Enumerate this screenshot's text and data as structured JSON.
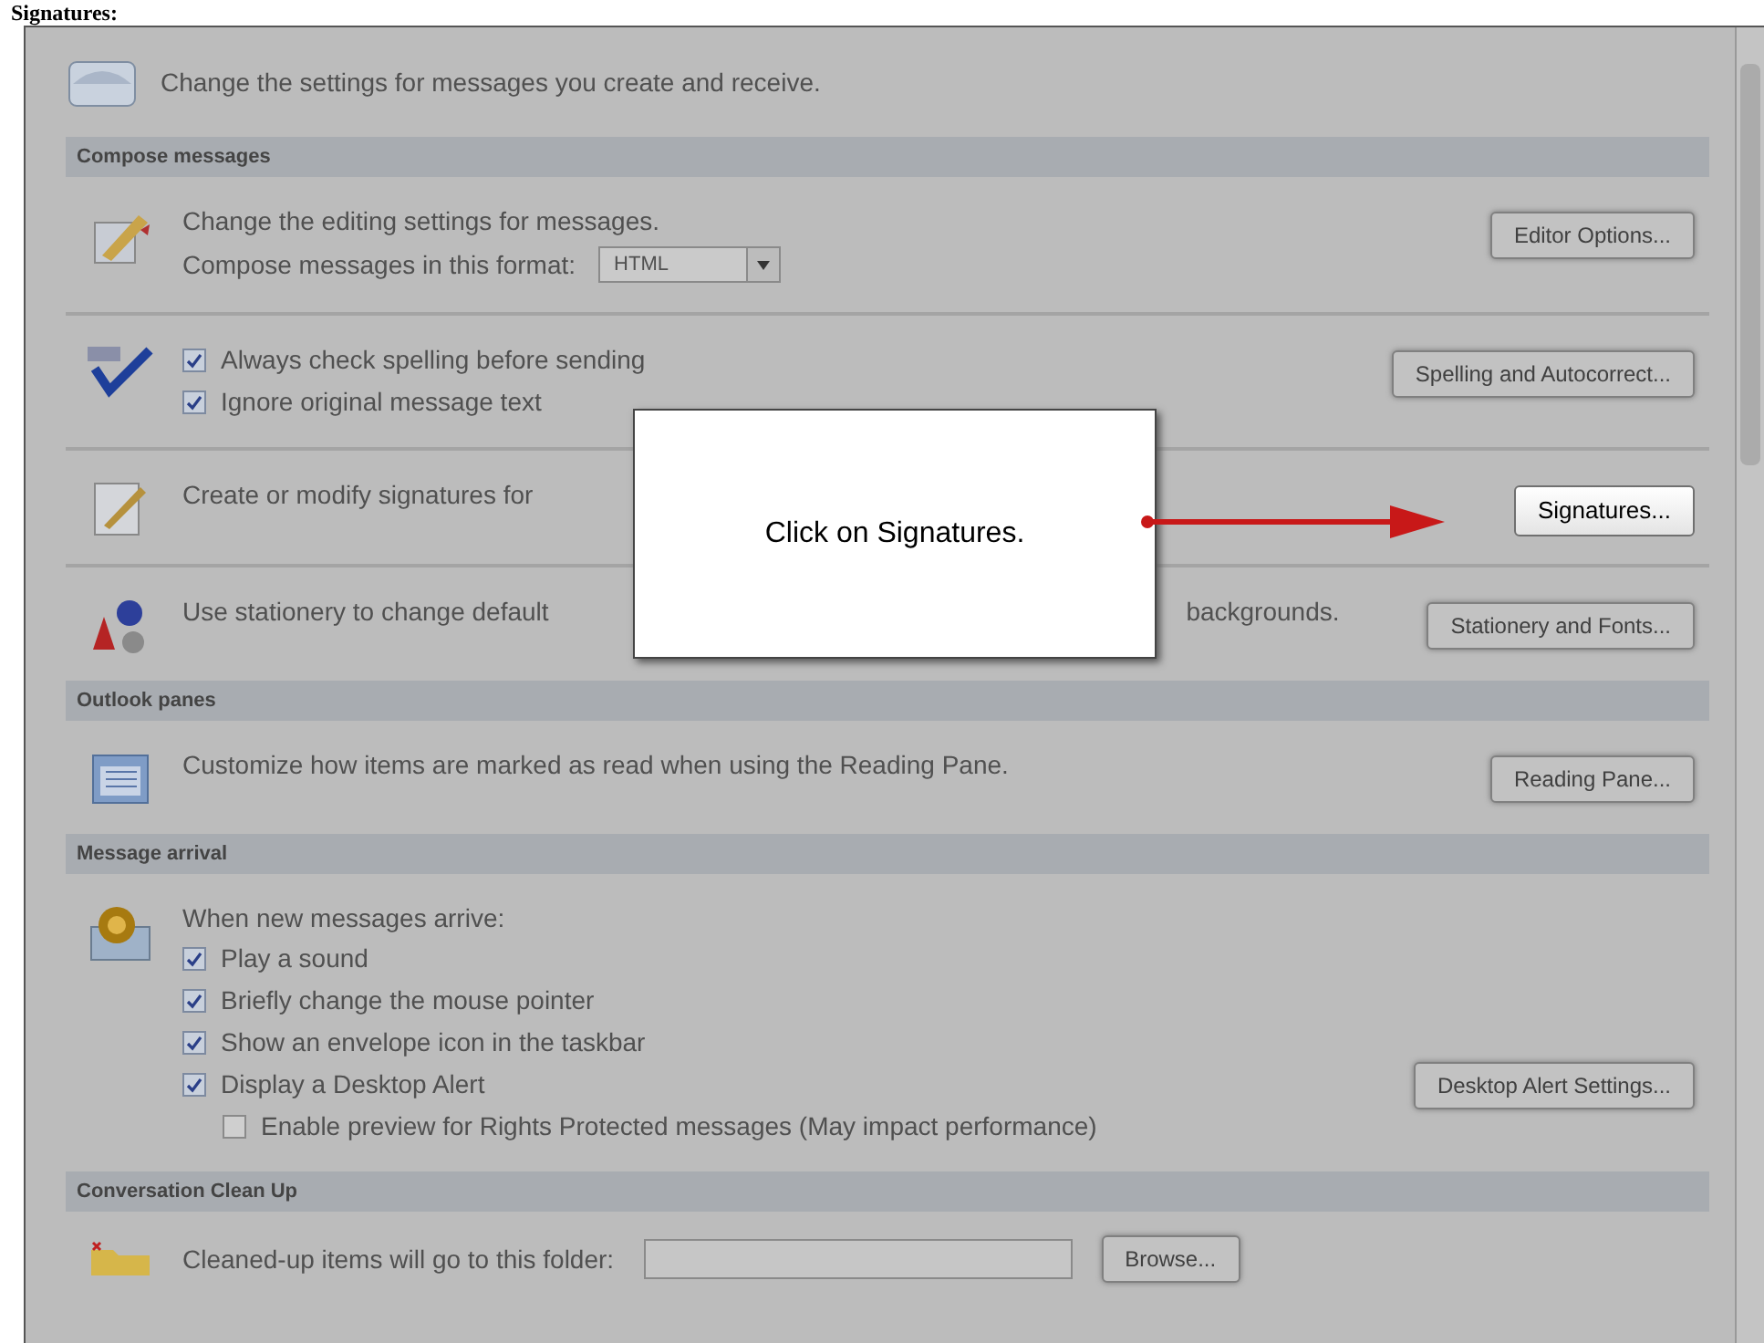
{
  "header": "Signatures:",
  "intro": "Change the settings for messages you create and receive.",
  "sections": [
    {
      "title": "Compose messages",
      "groups": [
        {
          "lines": [
            {
              "kind": "text",
              "text": "Change the editing settings for messages."
            },
            {
              "kind": "select",
              "label": "Compose messages in this format:",
              "value": "HTML"
            }
          ],
          "button": "Editor Options...",
          "highlighted": false
        },
        {
          "lines": [
            {
              "kind": "check",
              "label": "Always check spelling before sending",
              "checked": true
            },
            {
              "kind": "check",
              "label": "Ignore original message text",
              "checked": true
            }
          ],
          "button": "Spelling and Autocorrect...",
          "highlighted": false
        },
        {
          "lines": [
            {
              "kind": "text",
              "text": "Create or modify signatures for"
            }
          ],
          "button": "Signatures...",
          "highlighted": true
        },
        {
          "lines": [
            {
              "kind": "text",
              "text": "Use stationery to change default",
              "after": "backgrounds."
            }
          ],
          "button": "Stationery and Fonts...",
          "highlighted": false
        }
      ]
    },
    {
      "title": "Outlook panes",
      "groups": [
        {
          "lines": [
            {
              "kind": "text",
              "text": "Customize how items are marked as read when using the Reading Pane."
            }
          ],
          "button": "Reading Pane...",
          "highlighted": false
        }
      ]
    },
    {
      "title": "Message arrival",
      "groups": [
        {
          "lines": [
            {
              "kind": "text",
              "text": "When new messages arrive:"
            },
            {
              "kind": "check",
              "label": "Play a sound",
              "checked": true
            },
            {
              "kind": "check",
              "label": "Briefly change the mouse pointer",
              "checked": true
            },
            {
              "kind": "check",
              "label": "Show an envelope icon in the taskbar",
              "checked": true
            },
            {
              "kind": "check",
              "label": "Display a Desktop Alert",
              "checked": true,
              "button": "Desktop Alert Settings..."
            },
            {
              "kind": "subcheck",
              "label": "Enable preview for Rights Protected messages (May impact performance)",
              "checked": false
            }
          ]
        }
      ]
    },
    {
      "title": "Conversation Clean Up",
      "groups": [
        {
          "lines": [
            {
              "kind": "folder",
              "label": "Cleaned-up items will go to this folder:",
              "button": "Browse..."
            }
          ]
        }
      ]
    }
  ],
  "callout": {
    "text": "Click on Signatures."
  }
}
